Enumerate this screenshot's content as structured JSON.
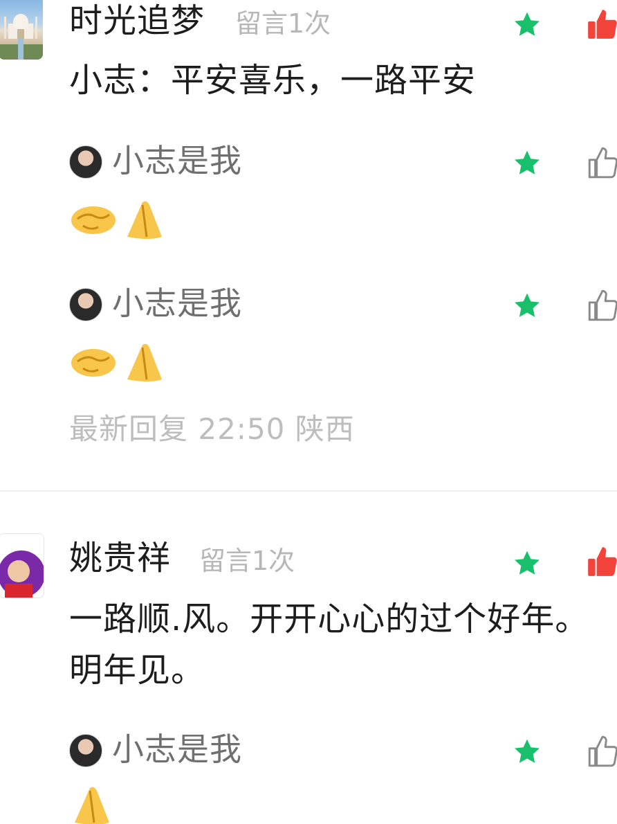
{
  "comments": [
    {
      "author": "时光追梦",
      "count": "留言1次",
      "text": "小志：平安喜乐，一路平安",
      "replies": [
        {
          "author": "小志是我",
          "content_icons": [
            "handshake-emoji",
            "folded-hands-emoji"
          ]
        },
        {
          "author": "小志是我",
          "content_icons": [
            "handshake-emoji",
            "folded-hands-emoji"
          ]
        }
      ],
      "latest_reply": "最新回复 22:50  陕西"
    },
    {
      "author": "姚贵祥",
      "count": "留言1次",
      "text_line1": "一路顺.风。开开心心的过个好年。",
      "text_line2": "明年见。",
      "replies": [
        {
          "author": "小志是我",
          "content_icons": [
            "folded-hands-emoji"
          ]
        }
      ]
    }
  ],
  "colors": {
    "star": "#19c06b",
    "like_active": "#f2443a",
    "like_inactive": "#8a8a8a",
    "muted_text": "#b7b7b7"
  },
  "icons": [
    "star-icon",
    "thumbs-up-icon",
    "thumbs-up-filled-icon",
    "handshake-emoji",
    "folded-hands-emoji"
  ]
}
